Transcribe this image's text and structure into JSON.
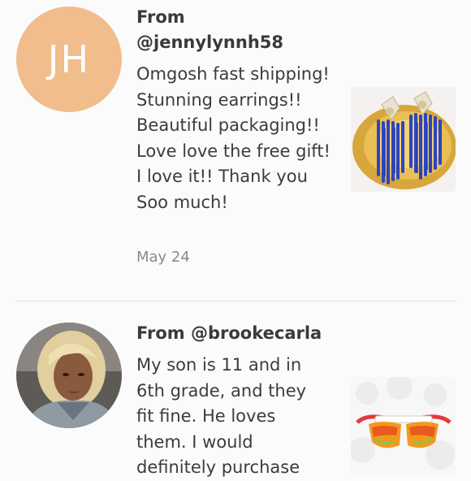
{
  "reviews": [
    {
      "avatar_initials": "JH",
      "avatar_color": "#f1bd8c",
      "from_prefix": "From",
      "handle": "@jennylynnh58",
      "text": "Omgosh fast shipping! Stunning earrings!! Beautiful packaging!! Love love the free gift! I love it!! Thank you Soo much!",
      "date": "May 24",
      "thumb_icon": "blue-beaded-earrings-photo"
    },
    {
      "avatar_icon": "user-photo-avatar",
      "from_prefix": "From",
      "handle": "@brookecarla",
      "text": "My son is 11 and in 6th grade, and they fit fine. He loves them. I would definitely purchase",
      "thumb_icon": "sport-sunglasses-photo"
    }
  ]
}
